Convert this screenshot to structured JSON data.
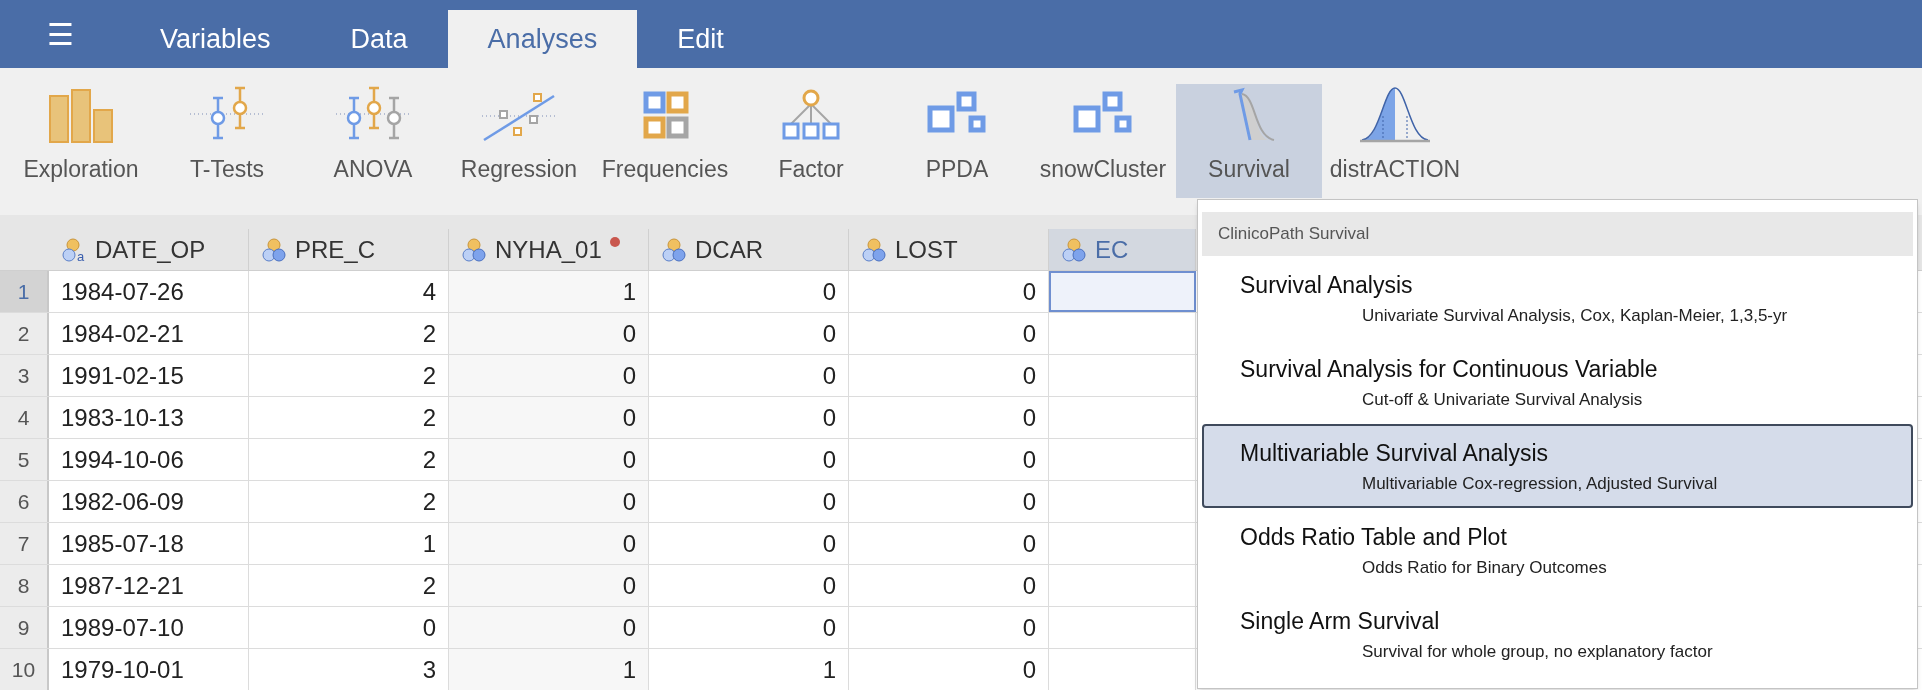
{
  "menu_button": {
    "label": "☰"
  },
  "tabs": [
    {
      "label": "Variables",
      "selected": false
    },
    {
      "label": "Data",
      "selected": false
    },
    {
      "label": "Analyses",
      "selected": true
    },
    {
      "label": "Edit",
      "selected": false
    }
  ],
  "toolbar": [
    {
      "label": "Exploration",
      "kind": "exploration",
      "selected": false
    },
    {
      "label": "T-Tests",
      "kind": "ttests",
      "selected": false
    },
    {
      "label": "ANOVA",
      "kind": "anova",
      "selected": false
    },
    {
      "label": "Regression",
      "kind": "regression",
      "selected": false
    },
    {
      "label": "Frequencies",
      "kind": "frequencies",
      "selected": false
    },
    {
      "label": "Factor",
      "kind": "factor",
      "selected": false
    },
    {
      "label": "PPDA",
      "kind": "cluster",
      "selected": false
    },
    {
      "label": "snowCluster",
      "kind": "cluster",
      "selected": false
    },
    {
      "label": "Survival",
      "kind": "survival",
      "selected": true
    },
    {
      "label": "distrACTION",
      "kind": "distribution",
      "selected": false
    }
  ],
  "table": {
    "columns": [
      {
        "name": "DATE_OP",
        "kind": "nominal_text",
        "icon_letter": "a",
        "changed": false,
        "selected": false
      },
      {
        "name": "PRE_C",
        "kind": "nominal",
        "changed": false,
        "selected": false
      },
      {
        "name": "NYHA_01",
        "kind": "nominal",
        "changed": true,
        "selected": false
      },
      {
        "name": "DCAR",
        "kind": "nominal",
        "changed": false,
        "selected": false
      },
      {
        "name": "LOST",
        "kind": "nominal",
        "changed": false,
        "selected": false
      },
      {
        "name": "EC",
        "kind": "nominal",
        "changed": false,
        "selected": true
      }
    ],
    "rows": [
      {
        "number": "1",
        "selected": true,
        "cells": [
          "1984-07-26",
          "4",
          "1",
          "0",
          "0",
          ""
        ]
      },
      {
        "number": "2",
        "selected": false,
        "cells": [
          "1984-02-21",
          "2",
          "0",
          "0",
          "0",
          ""
        ]
      },
      {
        "number": "3",
        "selected": false,
        "cells": [
          "1991-02-15",
          "2",
          "0",
          "0",
          "0",
          ""
        ]
      },
      {
        "number": "4",
        "selected": false,
        "cells": [
          "1983-10-13",
          "2",
          "0",
          "0",
          "0",
          ""
        ]
      },
      {
        "number": "5",
        "selected": false,
        "cells": [
          "1994-10-06",
          "2",
          "0",
          "0",
          "0",
          ""
        ]
      },
      {
        "number": "6",
        "selected": false,
        "cells": [
          "1982-06-09",
          "2",
          "0",
          "0",
          "0",
          ""
        ]
      },
      {
        "number": "7",
        "selected": false,
        "cells": [
          "1985-07-18",
          "1",
          "0",
          "0",
          "0",
          ""
        ]
      },
      {
        "number": "8",
        "selected": false,
        "cells": [
          "1987-12-21",
          "2",
          "0",
          "0",
          "0",
          ""
        ]
      },
      {
        "number": "9",
        "selected": false,
        "cells": [
          "1989-07-10",
          "0",
          "0",
          "0",
          "0",
          ""
        ]
      },
      {
        "number": "10",
        "selected": false,
        "cells": [
          "1979-10-01",
          "3",
          "1",
          "1",
          "0",
          ""
        ]
      }
    ]
  },
  "dropdown": {
    "header": "ClinicoPath Survival",
    "items": [
      {
        "title": "Survival Analysis",
        "subtitle": "Univariate Survival Analysis, Cox, Kaplan-Meier, 1,3,5-yr",
        "selected": false
      },
      {
        "title": "Survival Analysis for Continuous Variable",
        "subtitle": "Cut-off & Univariate Survival Analysis",
        "selected": false
      },
      {
        "title": "Multivariable Survival Analysis",
        "subtitle": "Multivariable Cox-regression, Adjusted Survival",
        "selected": true
      },
      {
        "title": "Odds Ratio Table and Plot",
        "subtitle": "Odds Ratio for Binary Outcomes",
        "selected": false
      },
      {
        "title": "Single Arm Survival",
        "subtitle": "Survival for whole group, no explanatory factor",
        "selected": false
      }
    ]
  }
}
